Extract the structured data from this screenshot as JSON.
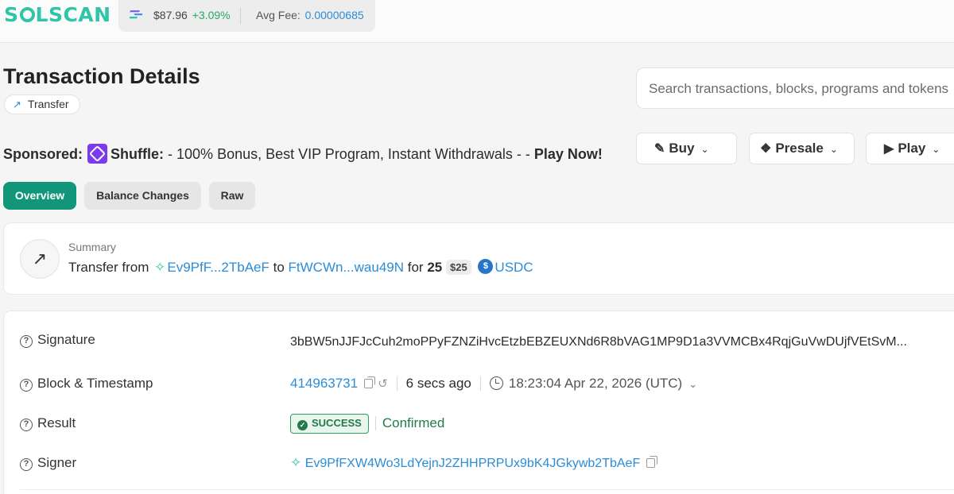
{
  "header": {
    "logo": "SOLSCAN",
    "sol_price": "$87.96",
    "sol_change": "+3.09%",
    "avg_fee_label": "Avg Fee:",
    "avg_fee_value": "0.00000685"
  },
  "page": {
    "title": "Transaction Details",
    "type_badge": "Transfer"
  },
  "search": {
    "placeholder": "Search transactions, blocks, programs and tokens"
  },
  "sponsored": {
    "label": "Sponsored:",
    "brand": "Shuffle:",
    "text": "- 100% Bonus, Best VIP Program, Instant Withdrawals - -",
    "cta": "Play Now!"
  },
  "dropdowns": [
    {
      "label": "Buy"
    },
    {
      "label": "Presale"
    },
    {
      "label": "Play"
    }
  ],
  "tabs": [
    {
      "label": "Overview"
    },
    {
      "label": "Balance Changes"
    },
    {
      "label": "Raw"
    }
  ],
  "summary": {
    "label": "Summary",
    "prefix": "Transfer from",
    "from": "Ev9PfF...2TbAeF",
    "to_label": "to",
    "to": "FtWCWn...wau49N",
    "for_label": "for",
    "amount": "25",
    "usd": "$25",
    "token": "USDC"
  },
  "details": {
    "signature_label": "Signature",
    "signature": "3bBW5nJJFJcCuh2moPPyFZNZiHvcEtzbEBZEUXNd6R8bVAG1MP9D1a3VVMCBx4RqjGuVwDUjfVEtSvM...",
    "block_label": "Block & Timestamp",
    "block": "414963731",
    "ago": "6 secs ago",
    "timestamp": "18:23:04 Apr 22, 2026 (UTC)",
    "result_label": "Result",
    "result": "SUCCESS",
    "confirmation": "Confirmed",
    "signer_label": "Signer",
    "signer": "Ev9PfFXW4Wo3LdYejnJ2ZHHPRPUx9bK4JGkywb2TbAeF"
  },
  "colors": {
    "accent": "#12967a",
    "link": "#2d8cd6",
    "success": "#237a4a",
    "logo": "#2ec5a8"
  }
}
